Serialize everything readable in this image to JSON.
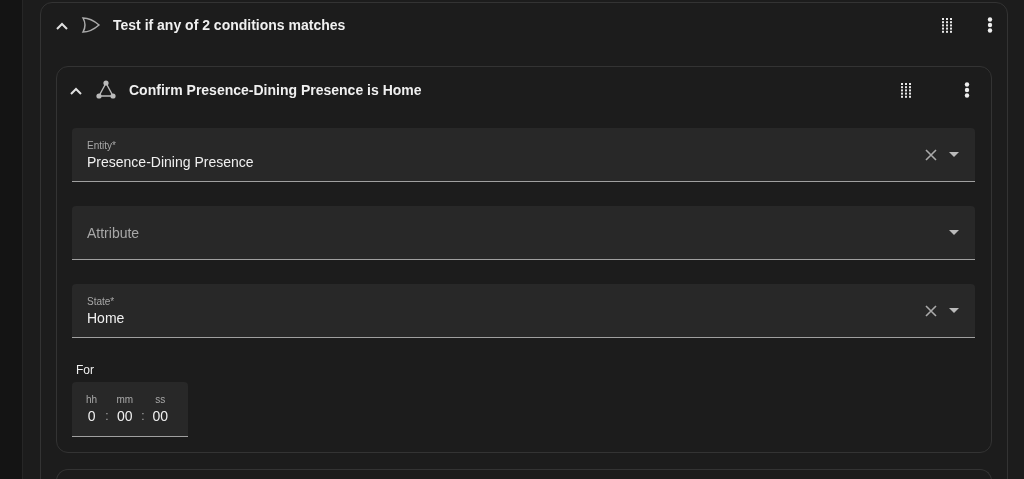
{
  "group": {
    "title": "Test if any of 2 conditions matches",
    "expanded": true
  },
  "condition": {
    "title": "Confirm Presence-Dining Presence is Home",
    "expanded": true,
    "fields": [
      {
        "label": "Entity*",
        "value": "Presence-Dining Presence"
      },
      {
        "label": "Attribute"
      },
      {
        "label": "State*",
        "value": "Home"
      }
    ],
    "duration": {
      "label": "For",
      "units": [
        {
          "label": "hh",
          "value": "0",
          "separator": ":"
        },
        {
          "label": "mm",
          "value": "00",
          "separator": ":"
        },
        {
          "label": "ss",
          "value": "00"
        }
      ]
    }
  }
}
